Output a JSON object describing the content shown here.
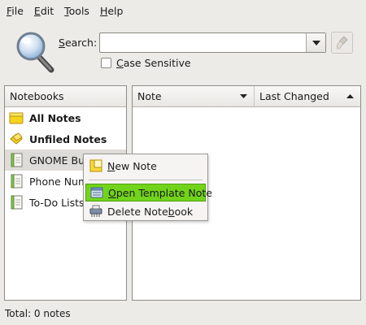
{
  "menubar": {
    "items": [
      {
        "label": "File",
        "accel": "F",
        "rest": "ile"
      },
      {
        "label": "Edit",
        "accel": "E",
        "rest": "dit"
      },
      {
        "label": "Tools",
        "accel": "T",
        "rest": "ools"
      },
      {
        "label": "Help",
        "accel": "H",
        "rest": "elp"
      }
    ]
  },
  "search": {
    "label_accel": "S",
    "label_rest": "earch:",
    "value": "",
    "case_label_pre": "",
    "case_label_accel": "C",
    "case_label_rest": "ase Sensitive",
    "case_checked": false
  },
  "notebooks": {
    "header": "Notebooks",
    "items": [
      {
        "label": "All Notes",
        "bold": true,
        "icon": "notes-folder-icon"
      },
      {
        "label": "Unfiled Notes",
        "bold": true,
        "icon": "unfiled-notes-icon"
      },
      {
        "label": "GNOME Bu",
        "bold": false,
        "icon": "notebook-icon",
        "selected": true
      },
      {
        "label": "Phone Num",
        "bold": false,
        "icon": "notebook-icon"
      },
      {
        "label": "To-Do Lists",
        "bold": false,
        "icon": "notebook-icon"
      }
    ]
  },
  "notes": {
    "columns": [
      {
        "label": "Note",
        "sort": "desc"
      },
      {
        "label": "Last Changed",
        "sort": "asc"
      }
    ]
  },
  "status": {
    "text": "Total:  0 notes"
  },
  "context_menu": {
    "items": [
      {
        "pre": "",
        "accel": "N",
        "rest": "ew Note",
        "icon": "new-note-icon"
      },
      {
        "pre": "",
        "accel": "O",
        "rest": "pen Template Note",
        "icon": "template-note-icon",
        "highlighted": true
      },
      {
        "pre": "Delete Note",
        "accel": "b",
        "rest": "ook",
        "icon": "shredder-icon"
      }
    ]
  },
  "colors": {
    "background": "#edebe8",
    "highlight": "#71d41b",
    "selected_row": "#dedcd8"
  }
}
